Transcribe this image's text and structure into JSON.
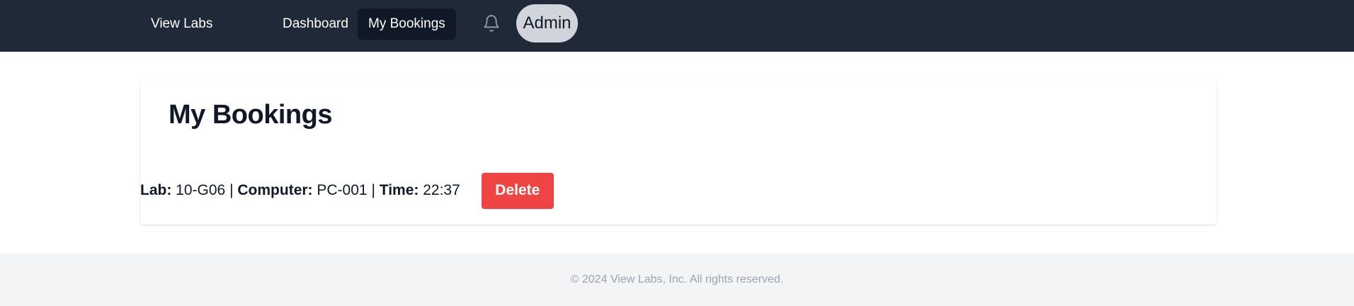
{
  "navbar": {
    "brand": "View Labs",
    "links": [
      {
        "label": "Dashboard"
      },
      {
        "label": "My Bookings",
        "active": true
      }
    ],
    "notifications_icon": "bell-icon",
    "avatar_label": "Admin"
  },
  "main": {
    "title": "My Bookings",
    "bookings": [
      {
        "lab_label": "Lab:",
        "lab": "10-G06",
        "separator": "|",
        "computer_label": "Computer:",
        "computer": "PC-001",
        "time_label": "Time:",
        "time": "22:37",
        "delete_label": "Delete"
      }
    ]
  },
  "footer": {
    "text": "© 2024 View Labs, Inc. All rights reserved."
  },
  "colors": {
    "navbar_bg": "#1f2937",
    "active_link_bg": "#111827",
    "delete_button": "#ef4444",
    "footer_bg": "#f3f4f6"
  }
}
